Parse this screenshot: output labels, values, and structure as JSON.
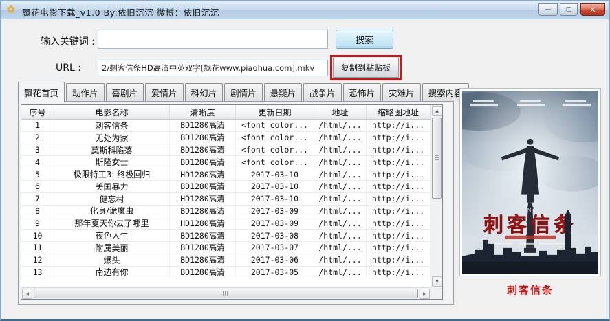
{
  "window": {
    "title": "飘花电影下载_v1.0  By:依旧沉沉  微博：依旧沉沉",
    "icon": "✿",
    "controls": {
      "minimize": "—",
      "maximize": "□",
      "close": "✕"
    }
  },
  "form": {
    "keyword_label": "输入关键词 :",
    "keyword_value": "",
    "search_button": "搜索",
    "url_label": "URL :",
    "url_value": "2/刺客信条HD高清中英双字[飘花www.piaohua.com].mkv",
    "copy_button": "复制到粘贴板",
    "copy_highlight_color": "#cf1414"
  },
  "tabs": {
    "items": [
      {
        "label": "飘花首页",
        "active": true
      },
      {
        "label": "动作片",
        "active": false
      },
      {
        "label": "喜剧片",
        "active": false
      },
      {
        "label": "爱情片",
        "active": false
      },
      {
        "label": "科幻片",
        "active": false
      },
      {
        "label": "剧情片",
        "active": false
      },
      {
        "label": "悬疑片",
        "active": false
      },
      {
        "label": "战争片",
        "active": false
      },
      {
        "label": "恐怖片",
        "active": false
      },
      {
        "label": "灾难片",
        "active": false
      },
      {
        "label": "搜索内容",
        "active": false
      }
    ]
  },
  "table": {
    "columns": [
      "序号",
      "电影名称",
      "清晰度",
      "更新日期",
      "地址",
      "缩略图地址"
    ],
    "rows": [
      [
        "1",
        "刺客信条",
        "BD1280高清",
        "<font color...",
        "/html/...",
        "http://i..."
      ],
      [
        "2",
        "无处为家",
        "BD1280高清",
        "<font color...",
        "/html/...",
        "http://i..."
      ],
      [
        "3",
        "莫斯科陷落",
        "BD1280高清",
        "<font color...",
        "/html/...",
        "http://i..."
      ],
      [
        "4",
        "斯隆女士",
        "BD1280高清",
        "<font color...",
        "/html/...",
        "http://i..."
      ],
      [
        "5",
        "极限特工3: 终极回归",
        "HD1280高清",
        "2017-03-10",
        "/html/...",
        "http://i..."
      ],
      [
        "6",
        "美国暴力",
        "BD1280高清",
        "2017-03-10",
        "/html/...",
        "http://i..."
      ],
      [
        "7",
        "健忘村",
        "HD1280高清",
        "2017-03-10",
        "/html/...",
        "http://i..."
      ],
      [
        "8",
        "化身/诡魔虫",
        "BD1280高清",
        "2017-03-09",
        "/html/...",
        "http://i..."
      ],
      [
        "9",
        "那年夏天你去了哪里",
        "HD1280高清",
        "2017-03-09",
        "/html/...",
        "http://i..."
      ],
      [
        "10",
        "夜色人生",
        "BD1280高清",
        "2017-03-08",
        "/html/...",
        "http://i..."
      ],
      [
        "11",
        "附属美丽",
        "BD1280高清",
        "2017-03-07",
        "/html/...",
        "http://i..."
      ],
      [
        "12",
        "爆头",
        "BD1280高清",
        "2017-03-06",
        "/html/...",
        "http://i..."
      ],
      [
        "13",
        "南边有你",
        "BD1280高清",
        "2017-03-05",
        "/html/...",
        "http://i..."
      ]
    ]
  },
  "scrollbars": {
    "up": "▲",
    "down": "▼",
    "left": "◀",
    "right": "▶"
  },
  "poster": {
    "title": "刺客信条",
    "title_en": "ASSASSINS CREED",
    "caption": "刺客信条",
    "title_color": "#bf1d1d",
    "caption_color": "#c71414"
  }
}
